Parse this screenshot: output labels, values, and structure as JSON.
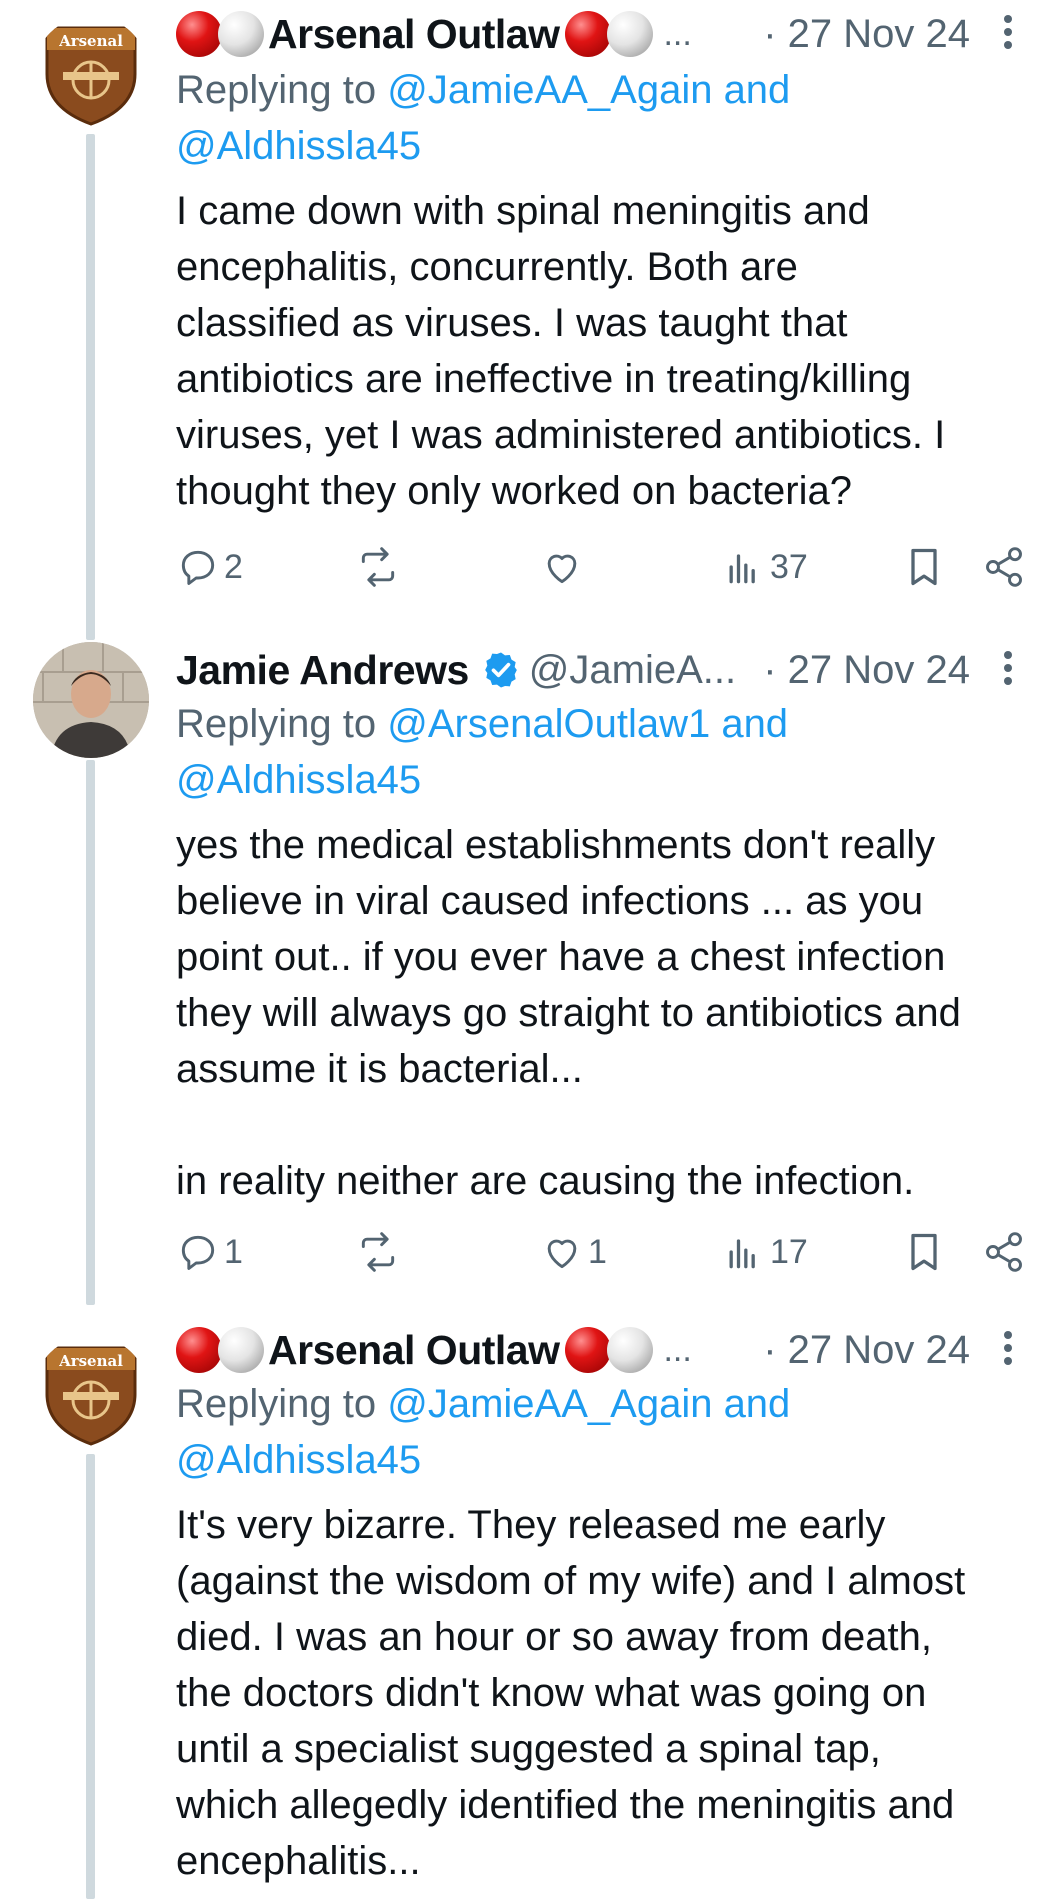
{
  "tweets": [
    {
      "author_name": "Arsenal Outlaw",
      "truncation": "...",
      "date": "· 27 Nov 24",
      "avatar_text": "Arsenal",
      "reply_prefix": "Replying to ",
      "reply_line1": "@JamieAA_Again and",
      "reply_line2": "@Aldhissla45",
      "text": "I came down with spinal meningitis and\nencephalitis, concurrently. Both are\nclassified as viruses. I was taught that\nantibiotics are ineffective in treating/killing\nviruses, yet I was administered antibiotics. I\nthought they only worked on bacteria?",
      "replies": "2",
      "reposts": "",
      "likes": "",
      "views": "37"
    },
    {
      "author_name": "Jamie Andrews",
      "handle": "@JamieA...",
      "date": "· 27 Nov 24",
      "reply_prefix": "Replying to ",
      "reply_line1": "@ArsenalOutlaw1 and",
      "reply_line2": "@Aldhissla45",
      "text": "yes the medical establishments don't really\nbelieve in viral caused infections ... as you\npoint out.. if you ever have a chest infection\nthey will always go straight to antibiotics and\nassume it is bacterial...\n\nin reality neither are causing the infection.",
      "replies": "1",
      "reposts": "",
      "likes": "1",
      "views": "17"
    },
    {
      "author_name": "Arsenal Outlaw",
      "truncation": "...",
      "date": "· 27 Nov 24",
      "avatar_text": "Arsenal",
      "reply_prefix": "Replying to ",
      "reply_line1": "@JamieAA_Again and",
      "reply_line2": "@Aldhissla45",
      "text": "It's very bizarre. They released me early\n(against the wisdom of my wife) and I almost\ndied. I was an hour or so away from death,\nthe doctors didn't know what was going on\nuntil a specialist suggested a spinal tap,\nwhich allegedly identified the meningitis and\nencephalitis..."
    }
  ],
  "colors": {
    "link": "#1d9bf0",
    "secondary_text": "#536471",
    "thread_line": "#cfd9de",
    "verified": "#1d9bf0"
  },
  "icons": [
    "reply-icon",
    "repost-icon",
    "like-icon",
    "views-icon",
    "bookmark-icon",
    "share-icon",
    "more-icon",
    "verified-icon"
  ]
}
